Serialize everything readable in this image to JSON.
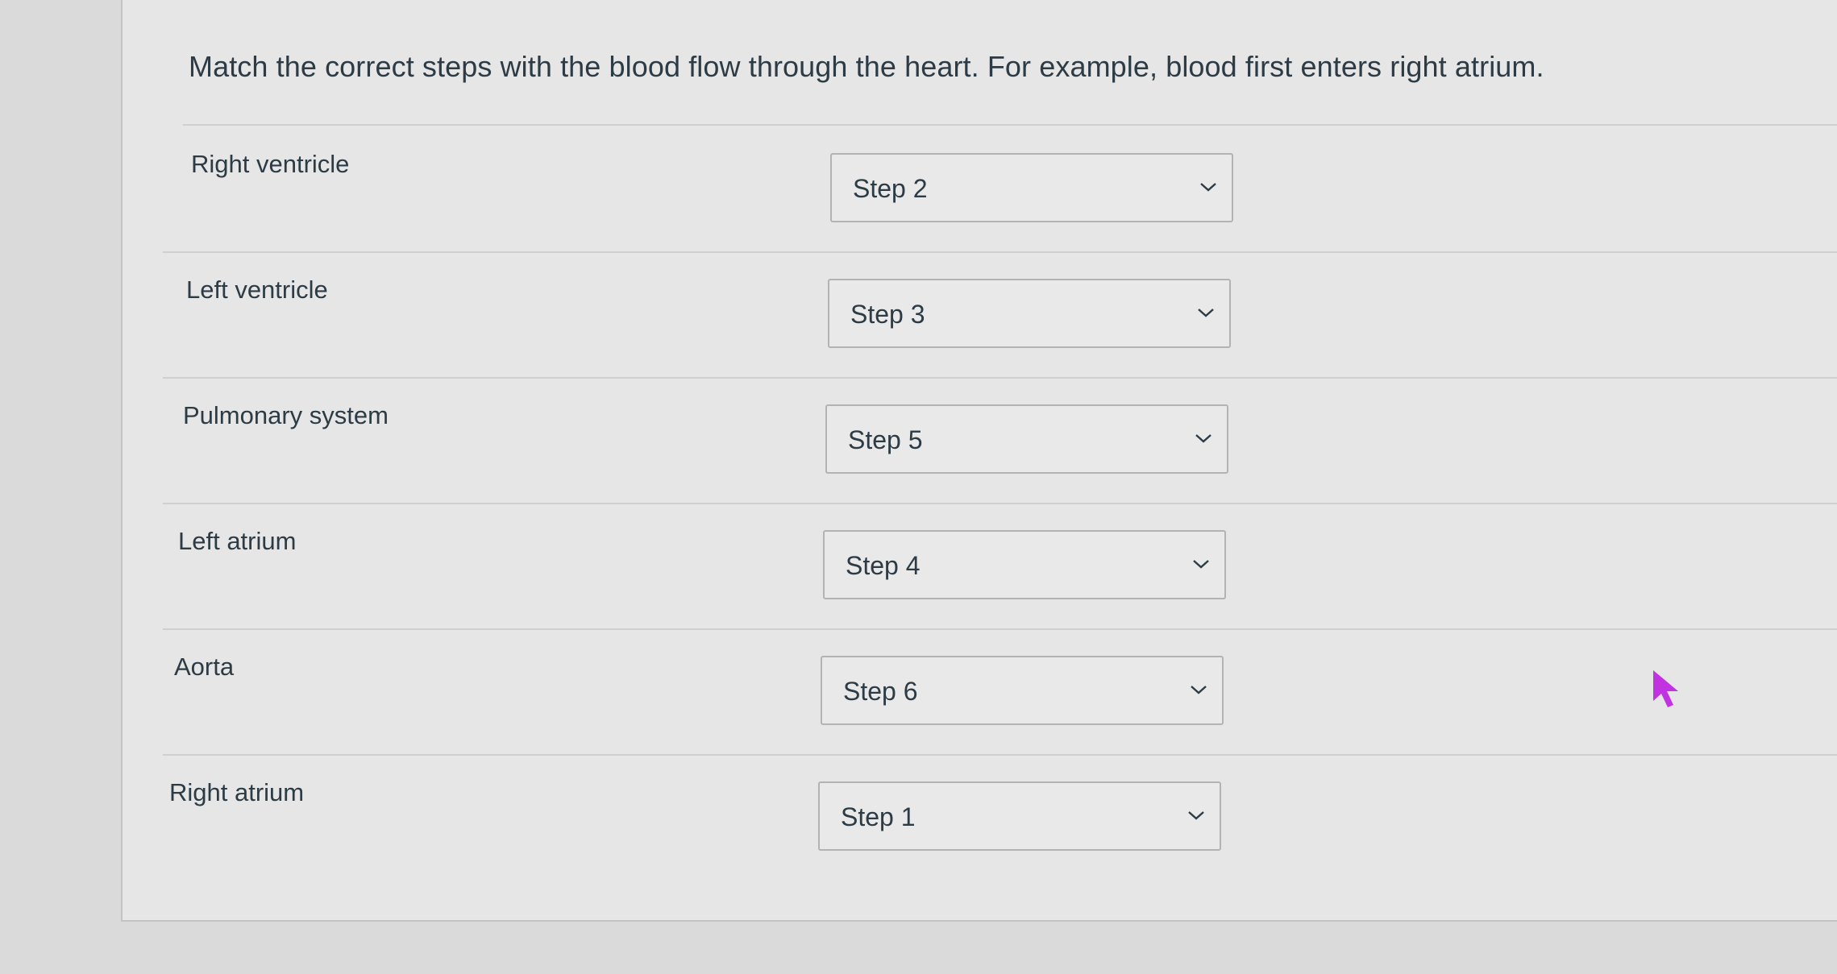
{
  "question": {
    "prompt": "Match the correct steps with the blood flow through the heart. For example, blood first enters right atrium."
  },
  "rows": [
    {
      "label": "Right ventricle",
      "selected": "Step 2"
    },
    {
      "label": "Left ventricle",
      "selected": "Step 3"
    },
    {
      "label": "Pulmonary system",
      "selected": "Step 5"
    },
    {
      "label": "Left atrium",
      "selected": "Step 4"
    },
    {
      "label": "Aorta",
      "selected": "Step 6"
    },
    {
      "label": "Right atrium",
      "selected": "Step 1"
    }
  ],
  "icons": {
    "dropdown": "chevron-down-icon",
    "pointer": "mouse-cursor-icon"
  },
  "colors": {
    "text": "#2d3b45",
    "cursor": "#c133e0",
    "select_border": "#b3b3b3"
  }
}
